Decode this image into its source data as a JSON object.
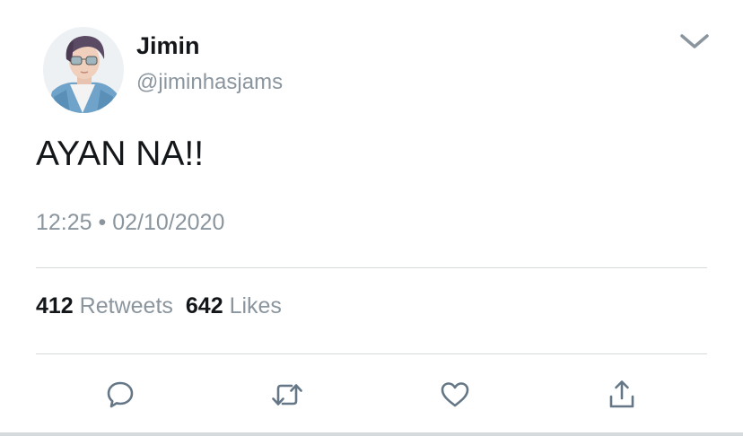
{
  "user": {
    "display_name": "Jimin",
    "handle": "@jiminhasjams",
    "avatar_icon": "profile-photo"
  },
  "tweet": {
    "text": "AYAN NA!!",
    "time": "12:25",
    "separator": "•",
    "date": "02/10/2020"
  },
  "stats": {
    "retweets_count": "412",
    "retweets_label": "Retweets",
    "likes_count": "642",
    "likes_label": "Likes"
  },
  "actions": {
    "reply_icon": "reply-icon",
    "retweet_icon": "retweet-icon",
    "like_icon": "heart-icon",
    "share_icon": "share-icon"
  },
  "colors": {
    "text": "#14171a",
    "secondary": "#8a959e",
    "divider": "#d5dadd",
    "icon": "#657786"
  }
}
